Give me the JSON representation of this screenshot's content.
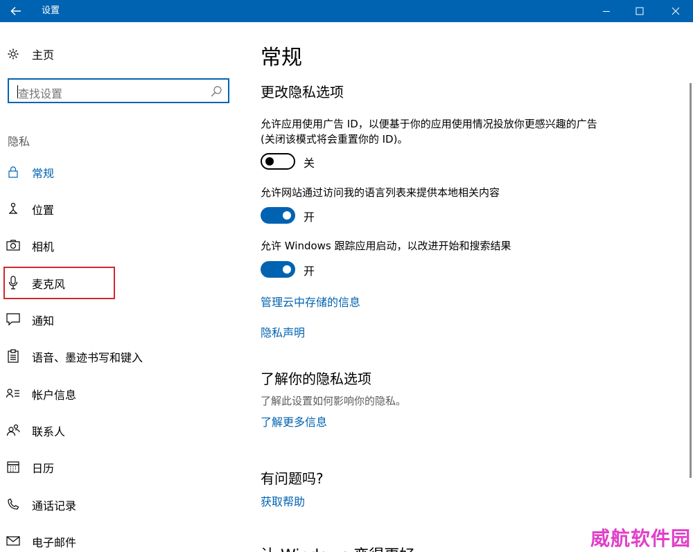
{
  "window": {
    "title": "设置",
    "back_icon": "back-arrow-icon",
    "controls": {
      "minimize": "minimize-icon",
      "maximize": "maximize-icon",
      "close": "close-icon"
    },
    "accent_color": "#0063b1"
  },
  "sidebar": {
    "home": {
      "label": "主页",
      "icon": "gear-icon"
    },
    "search": {
      "placeholder": "查找设置",
      "icon": "search-icon"
    },
    "section": "隐私",
    "items": [
      {
        "label": "常规",
        "icon": "lock-icon",
        "active": true
      },
      {
        "label": "位置",
        "icon": "location-icon"
      },
      {
        "label": "相机",
        "icon": "camera-icon"
      },
      {
        "label": "麦克风",
        "icon": "microphone-icon",
        "highlighted": true
      },
      {
        "label": "通知",
        "icon": "notification-icon"
      },
      {
        "label": "语音、墨迹书写和键入",
        "icon": "clipboard-icon"
      },
      {
        "label": "帐户信息",
        "icon": "account-info-icon"
      },
      {
        "label": "联系人",
        "icon": "contacts-icon"
      },
      {
        "label": "日历",
        "icon": "calendar-icon"
      },
      {
        "label": "通话记录",
        "icon": "call-history-icon"
      },
      {
        "label": "电子邮件",
        "icon": "email-icon"
      }
    ],
    "highlight_color": "#d0262d"
  },
  "main": {
    "title": "常规",
    "privacy_options": {
      "heading": "更改隐私选项",
      "settings": [
        {
          "description": "允许应用使用广告 ID，以便基于你的应用使用情况投放你更感兴趣的广告(关闭该模式将会重置你的 ID)。",
          "state": "关",
          "on": false
        },
        {
          "description": "允许网站通过访问我的语言列表来提供本地相关内容",
          "state": "开",
          "on": true
        },
        {
          "description": "允许 Windows 跟踪应用启动，以改进开始和搜索结果",
          "state": "开",
          "on": true
        }
      ],
      "links": [
        "管理云中存储的信息",
        "隐私声明"
      ]
    },
    "learn": {
      "heading": "了解你的隐私选项",
      "text": "了解此设置如何影响你的隐私。",
      "link": "了解更多信息"
    },
    "help": {
      "heading": "有问题吗?",
      "link": "获取帮助"
    },
    "cut_off_heading": "让 Windows 变得更好"
  },
  "watermark": "威航软件园"
}
